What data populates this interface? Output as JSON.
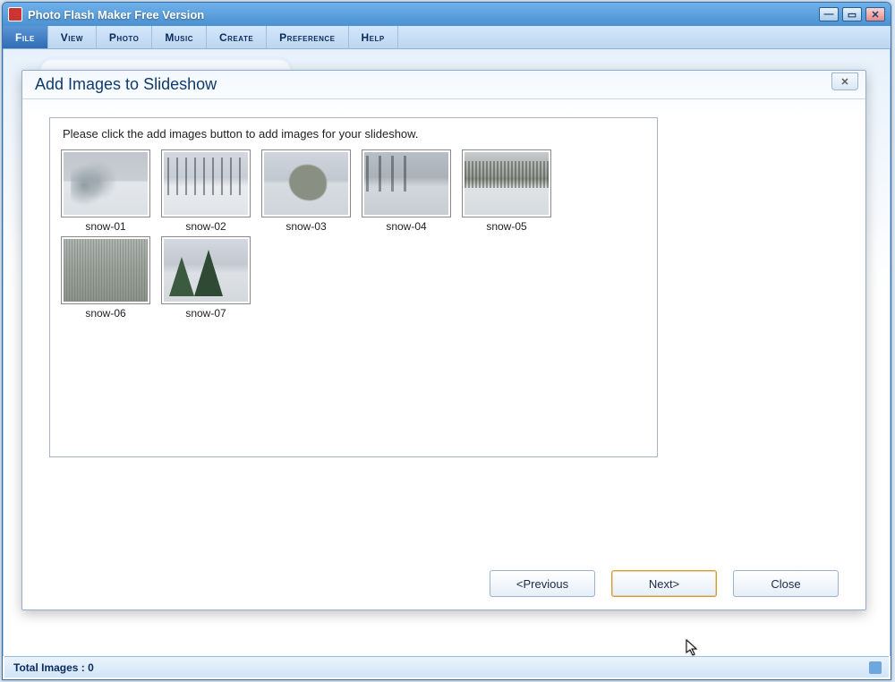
{
  "window": {
    "title": "Photo Flash Maker Free Version"
  },
  "menu": {
    "items": [
      {
        "label": "File",
        "active": true
      },
      {
        "label": "View",
        "active": false
      },
      {
        "label": "Photo",
        "active": false
      },
      {
        "label": "Music",
        "active": false
      },
      {
        "label": "Create",
        "active": false
      },
      {
        "label": "Preference",
        "active": false
      },
      {
        "label": "Help",
        "active": false
      }
    ]
  },
  "statusbar": {
    "total_images_label": "Total Images : 0"
  },
  "dialog": {
    "title": "Add Images to Slideshow",
    "instruction": "Please click the add images button to add  images for your slideshow.",
    "thumbnails": [
      {
        "caption": "snow-01",
        "style": "snow-a"
      },
      {
        "caption": "snow-02",
        "style": "snow-b"
      },
      {
        "caption": "snow-03",
        "style": "snow-c"
      },
      {
        "caption": "snow-04",
        "style": "snow-d"
      },
      {
        "caption": "snow-05",
        "style": "snow-e"
      },
      {
        "caption": "snow-06",
        "style": "snow-f"
      },
      {
        "caption": "snow-07",
        "style": "snow-g"
      }
    ],
    "buttons": {
      "previous": "<Previous",
      "next": "Next>",
      "close": "Close"
    }
  }
}
